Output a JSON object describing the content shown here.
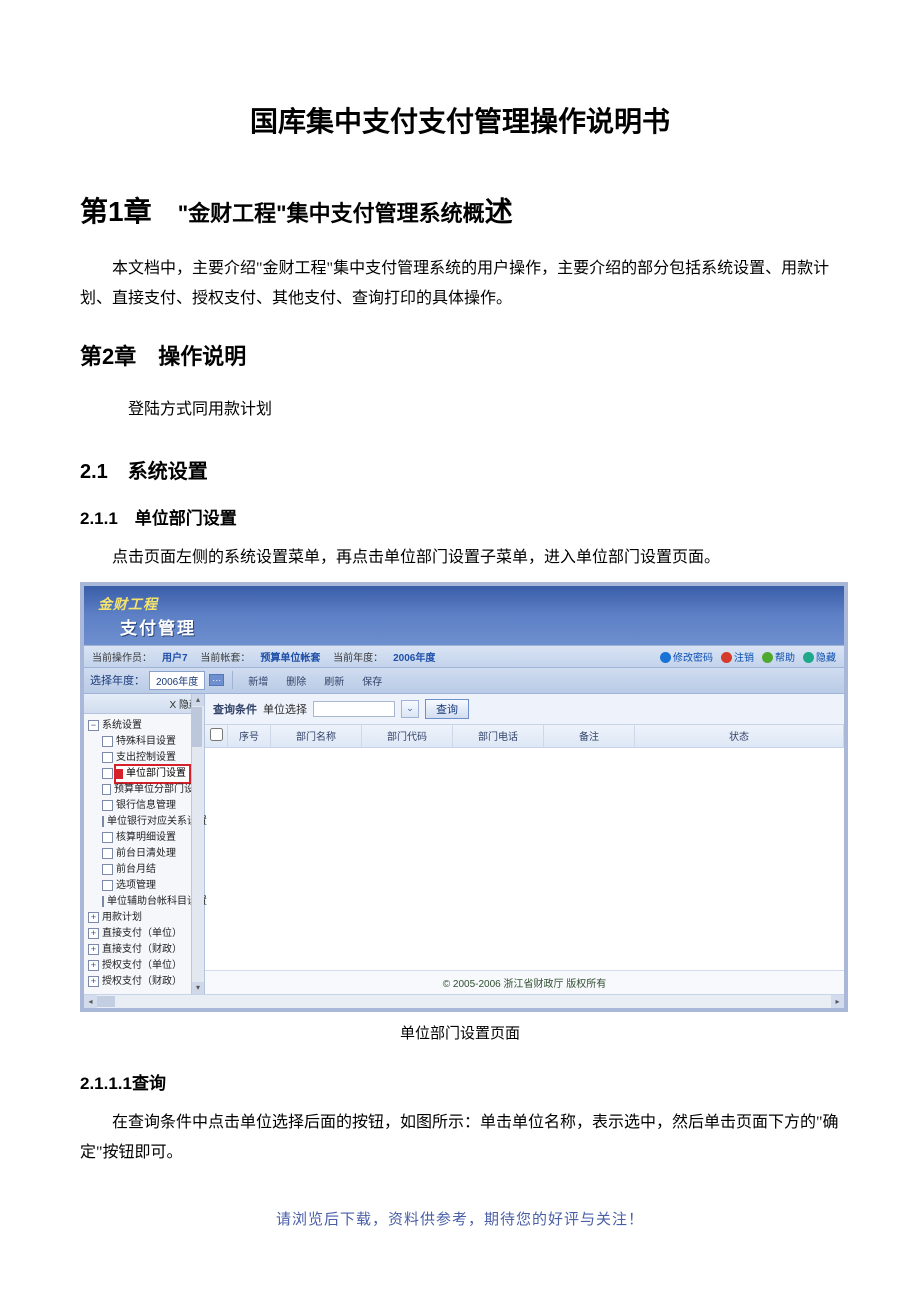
{
  "doc": {
    "title": "国库集中支付支付管理操作说明书",
    "chapter1_prefix": "第1章",
    "chapter1_quote_open": "\"",
    "chapter1_name": "金财工程",
    "chapter1_quote_close": "\"",
    "chapter1_rest": "集中支付管理系统概",
    "chapter1_tail": "述",
    "intro_para": "本文档中，主要介绍\"金财工程\"集中支付管理系统的用户操作，主要介绍的部分包括系统设置、用款计划、直接支付、授权支付、其他支付、查询打印的具体操作。",
    "chapter2": "第2章　操作说明",
    "login_para": "登陆方式同用款计划",
    "sec21": "2.1　系统设置",
    "sec211": "2.1.1　单位部门设置",
    "sec211_para": "点击页面左侧的系统设置菜单，再点击单位部门设置子菜单，进入单位部门设置页面。",
    "caption": "单位部门设置页面",
    "sec2111": "2.1.1.1查询",
    "sec2111_para": "在查询条件中点击单位选择后面的按钮，如图所示：单击单位名称，表示选中，然后单击页面下方的\"确定\"按钮即可。",
    "footer": "请浏览后下载，资料供参考，期待您的好评与关注！"
  },
  "app": {
    "logo1": "金财工程",
    "logo2": "支付管理",
    "info": {
      "operator_label": "当前操作员：",
      "operator": "用户7",
      "account_label": "当前帐套：",
      "account": "预算单位帐套",
      "year_label": "当前年度：",
      "year": "2006年度"
    },
    "links": {
      "pwd": "修改密码",
      "logout": "注销",
      "help": "帮助",
      "hide": "隐藏"
    },
    "year_picker": {
      "label": "选择年度：",
      "value": "2006年度"
    },
    "toolbar": {
      "add": "新增",
      "del": "删除",
      "refresh": "刷新",
      "save": "保存"
    },
    "hide_btn": "X 隐藏",
    "query": {
      "label": "查询条件",
      "unit_label": "单位选择",
      "btn": "查询"
    },
    "columns": {
      "chk": "",
      "seq": "序号",
      "dept_name": "部门名称",
      "dept_code": "部门代码",
      "dept_tel": "部门电话",
      "remark": "备注",
      "status": "状态"
    },
    "status_bar": "© 2005-2006 浙江省财政厅 版权所有",
    "tree": {
      "root": "系统设置",
      "items": [
        "特殊科目设置",
        "支出控制设置",
        "单位部门设置",
        "预算单位分部门设置",
        "银行信息管理",
        "单位银行对应关系设置",
        "核算明细设置",
        "前台日清处理",
        "前台月结",
        "选项管理",
        "单位辅助台帐科目设置"
      ],
      "groups": [
        "用款计划",
        "直接支付（单位）",
        "直接支付（财政）",
        "授权支付（单位）",
        "授权支付（财政）"
      ]
    }
  }
}
